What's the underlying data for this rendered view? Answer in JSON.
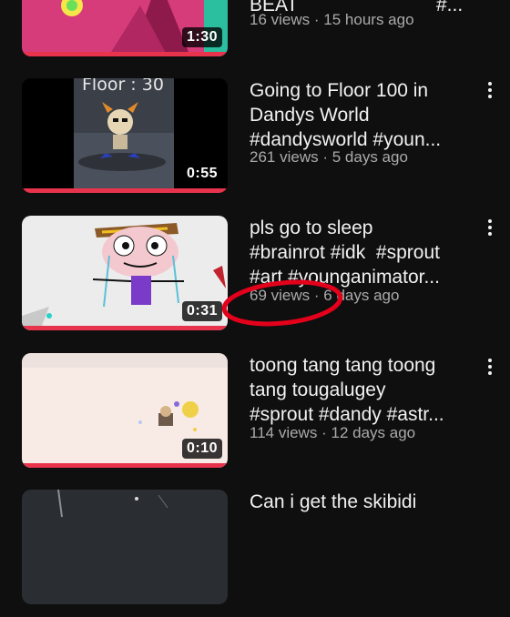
{
  "videos": [
    {
      "title_lines": [
        "BEAT",
        "#..."
      ],
      "views": "16 views",
      "sep": "·",
      "age": "15 hours ago",
      "duration": "1:30",
      "thumb_icon": "pink-abstract-thumbnail"
    },
    {
      "title_lines": [
        "Going to Floor 100 in",
        "Dandys World",
        "#dandysworld #youn..."
      ],
      "views": "261 views",
      "sep": "·",
      "age": "5 days ago",
      "duration": "0:55",
      "thumb_text": "Floor : 30",
      "thumb_icon": "dandy-character-thumbnail"
    },
    {
      "title_lines": [
        "pls go to sleep",
        "#brainrot #idk  #sprout",
        "#art #younganimator..."
      ],
      "views": "69 views",
      "sep": "·",
      "age": "6 days ago",
      "duration": "0:31",
      "thumb_icon": "cowboy-character-thumbnail"
    },
    {
      "title_lines": [
        "toong tang tang toong",
        "tang tougalugey",
        "#sprout #dandy #astr..."
      ],
      "views": "114 views",
      "sep": "·",
      "age": "12 days ago",
      "duration": "0:10",
      "thumb_icon": "sprout-character-thumbnail"
    },
    {
      "title_lines": [
        "Can i get the skibidi"
      ],
      "thumb_icon": "dark-thumbnail"
    }
  ],
  "colors": {
    "background": "#0f0f0f",
    "progress": "#e8334d",
    "annotation": "#e3001b",
    "meta_text": "#aaaaaa"
  }
}
